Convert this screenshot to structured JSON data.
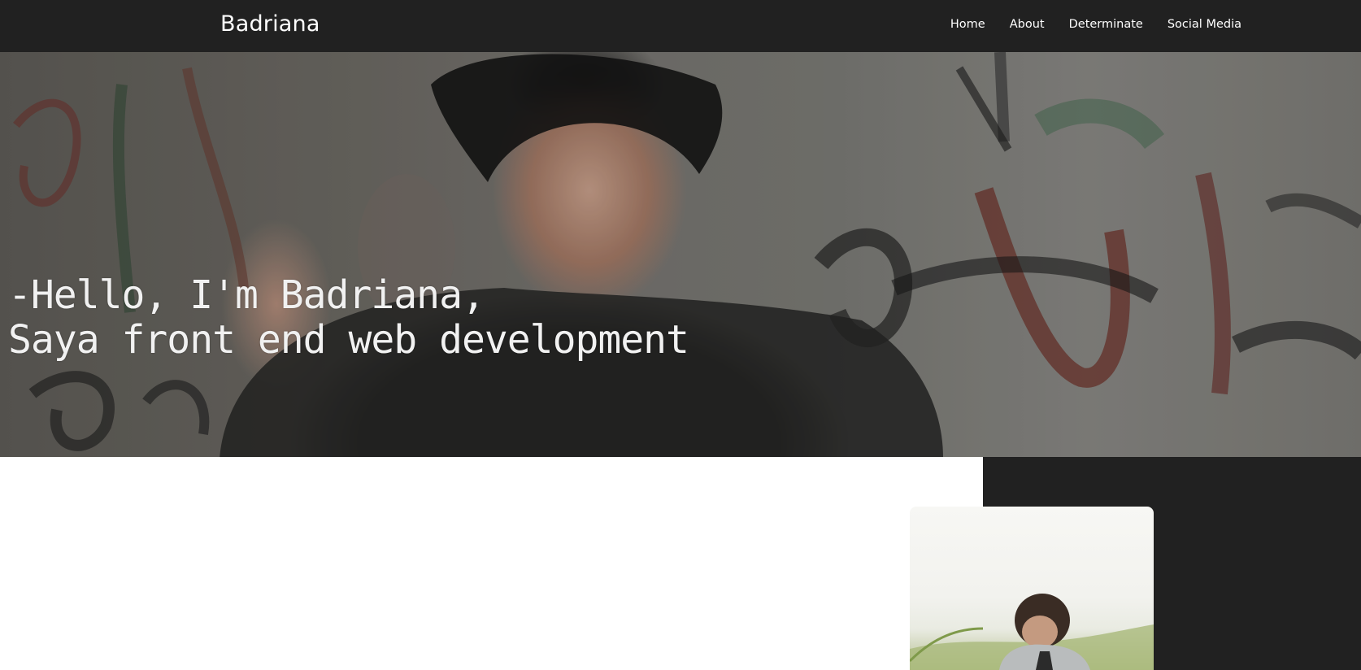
{
  "navbar": {
    "brand": "Badriana",
    "links": [
      {
        "label": "Home"
      },
      {
        "label": "About"
      },
      {
        "label": "Determinate"
      },
      {
        "label": "Social Media"
      }
    ]
  },
  "hero": {
    "line1": "-Hello, I'm Badriana,",
    "line2": "Saya front end web development"
  },
  "colors": {
    "navbar_bg": "#212121",
    "panel_bg": "#212121",
    "text_light": "#ffffff"
  }
}
